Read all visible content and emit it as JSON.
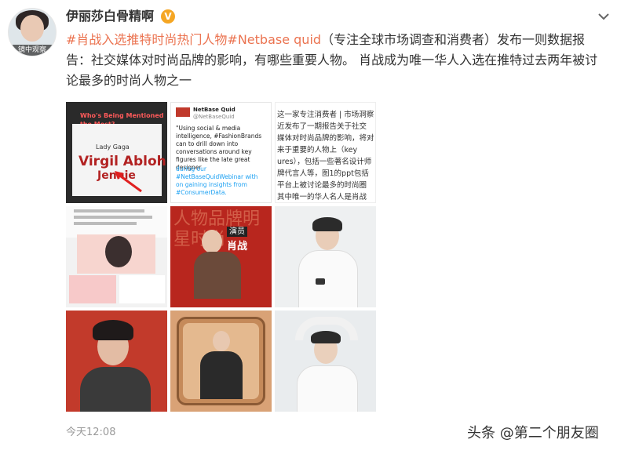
{
  "post": {
    "username": "伊丽莎白骨精啊",
    "avatar_label": "镜中观察",
    "hashtag1": "#肖战入选推特时尚热门人物",
    "hashtag2": "#Netbase quid",
    "body_part1": "（专注全球市场调查和消费者）发布一则数据报",
    "body_line2": "告：社交媒体对时尚品牌的影响，有哪些重要人物。 肖战成为唯一华人入选在推特过去两年被讨",
    "body_line3": "论最多的时尚人物之一",
    "timestamp": "今天12:08",
    "watermark": "头条 @第二个朋友圈"
  },
  "images": {
    "img1": {
      "title": "Who's Being Mentioned the Most?",
      "word1": "Virgil Abloh",
      "word2": "Jennie",
      "word3": "Lady Gaga"
    },
    "img2": {
      "account": "NetBase Quid",
      "handle": "@NetBaseQuid",
      "text": "\"Using social & media intelligence, #FashionBrands can to drill down into conversations around key figures like the late great designer",
      "text2": "during our #NetBaseQuidWebinar with",
      "text3": "on gaining insights from #ConsumerData."
    },
    "img3": {
      "lines": [
        "这一家专注消费者 | 市场洞察",
        "近发布了一期报告关于社交",
        "媒体对时尚品牌的影响，将对",
        "来于重要的人物上（key",
        "ures），包括一些著名设计师",
        "牌代言人等，图1的ppt包括",
        "平台上被讨论最多的时尚圈",
        "其中唯一的华人名人是肖战"
      ]
    },
    "img5": {
      "poster_text": "演员",
      "poster_name": "肖战"
    }
  }
}
